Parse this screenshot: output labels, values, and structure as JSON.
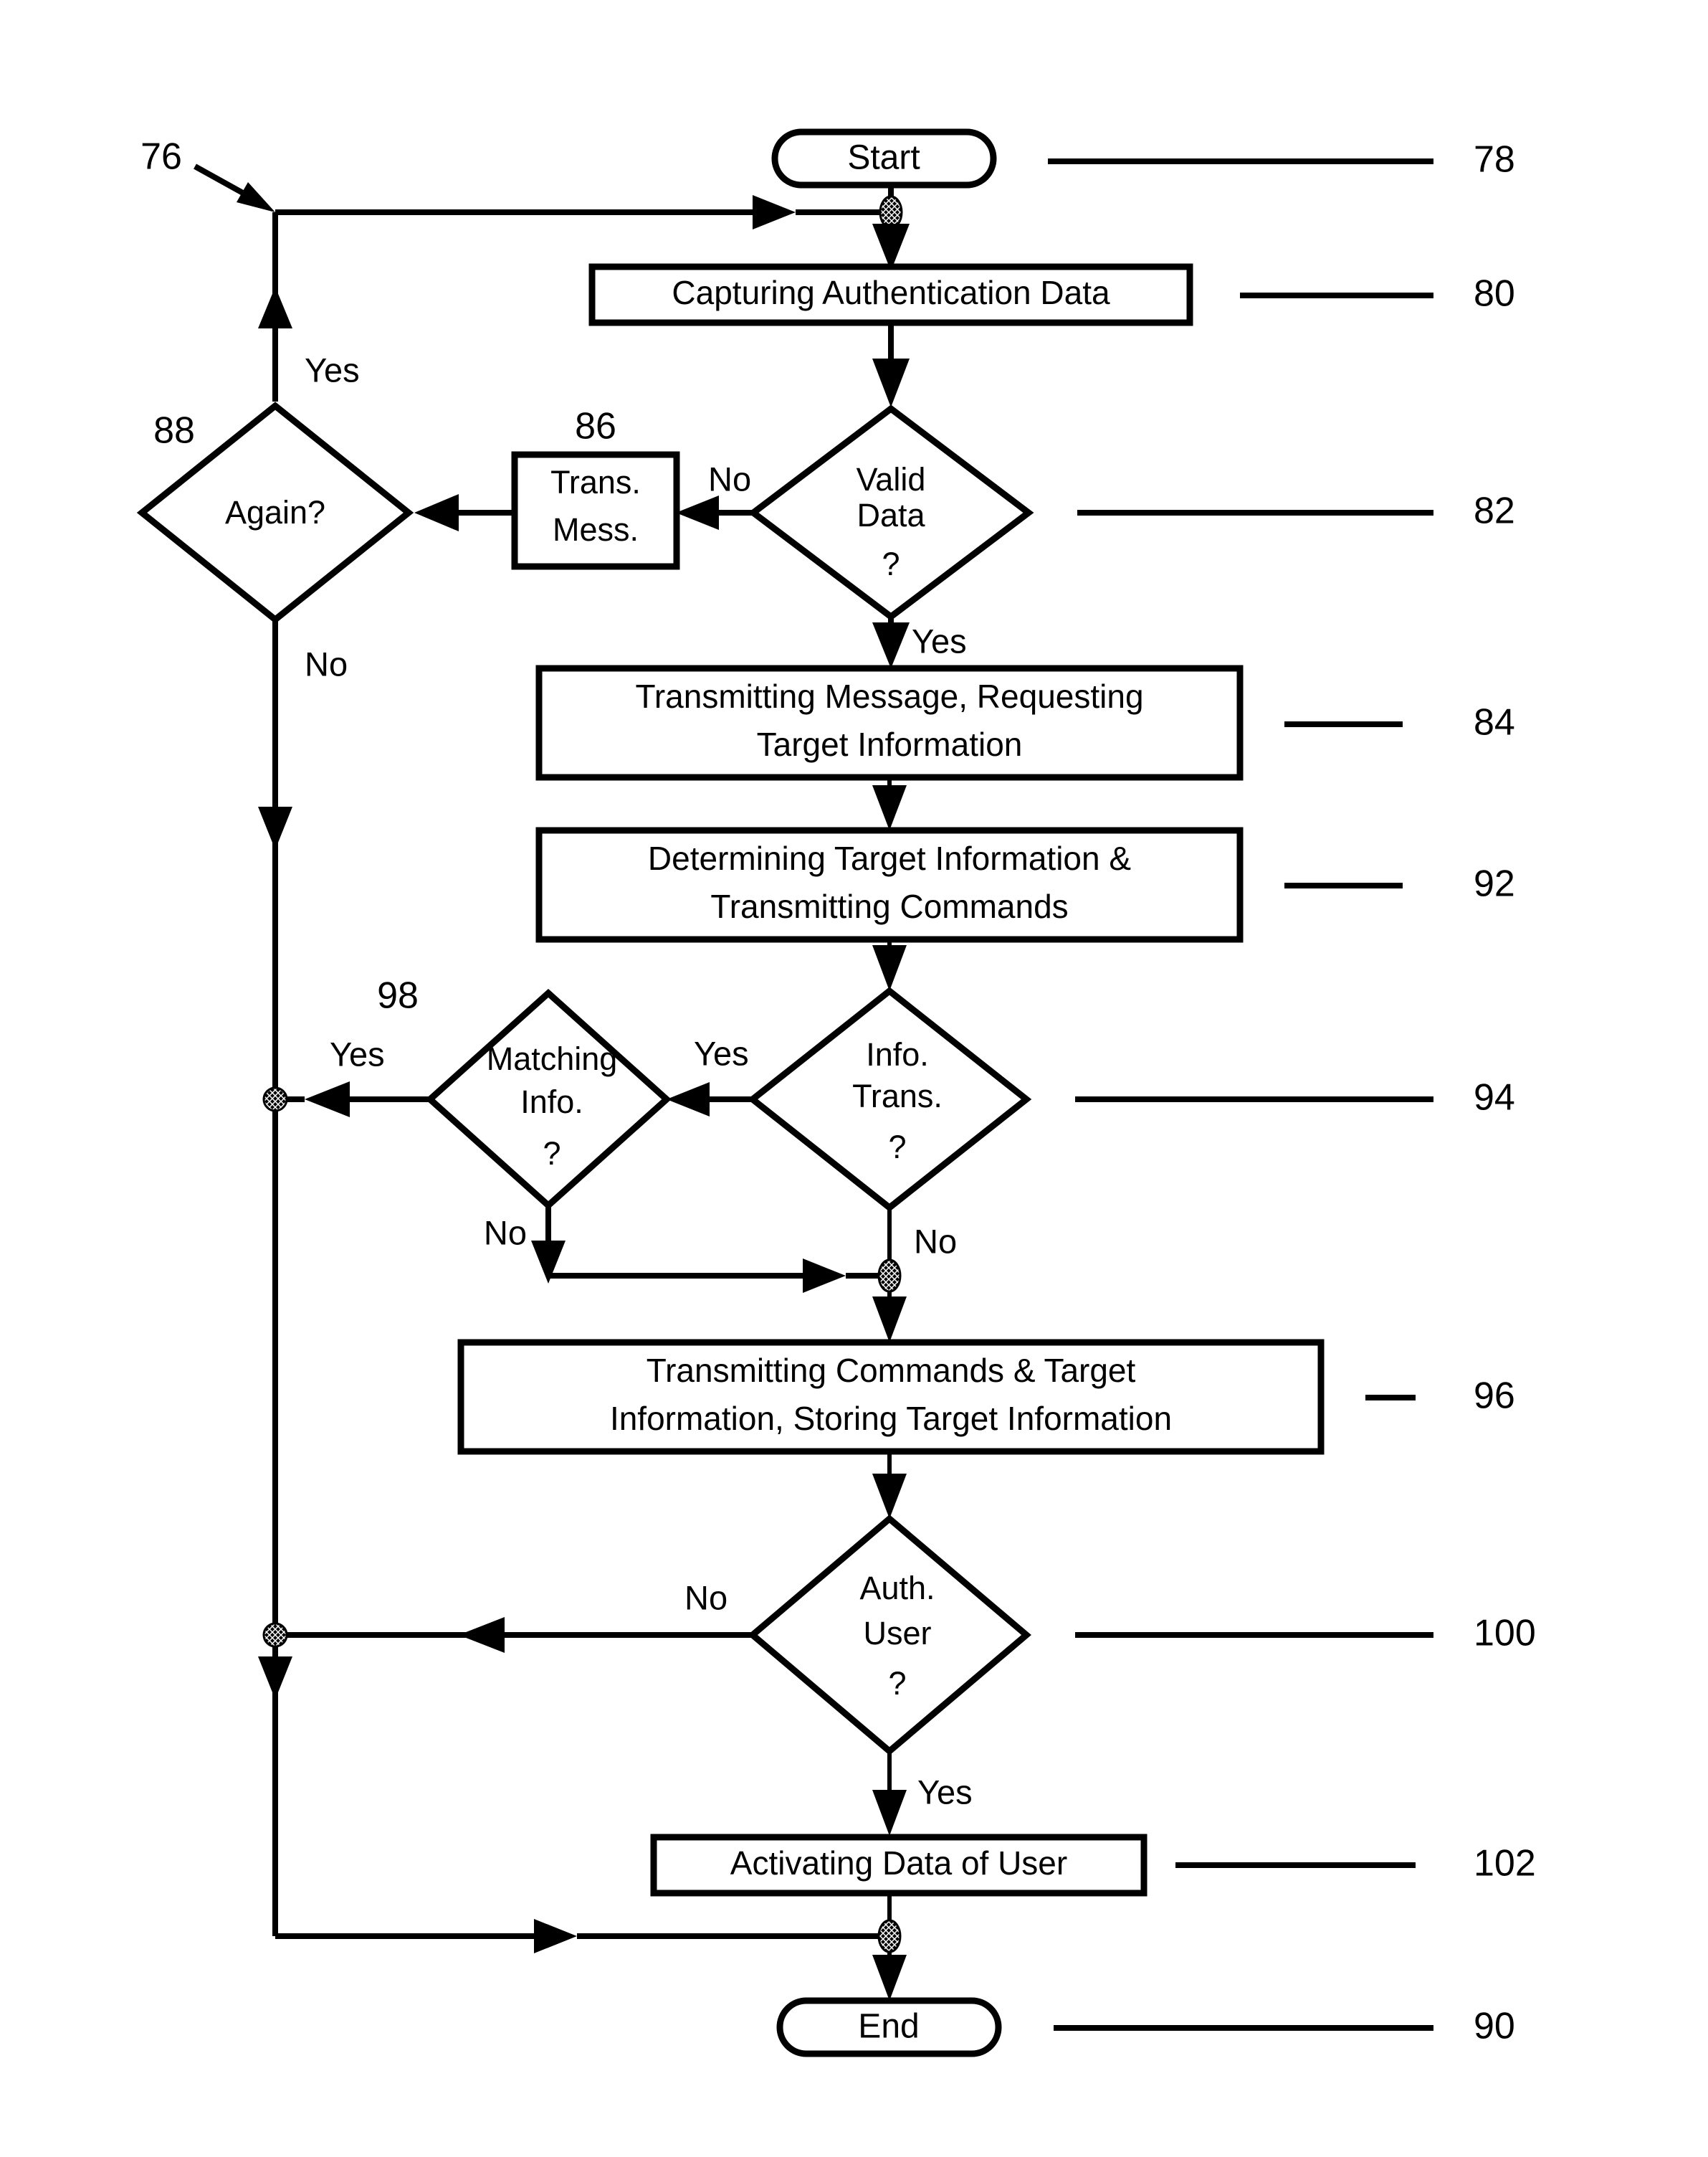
{
  "figure": {
    "type": "patent-flowchart",
    "figure_reference": "76",
    "background_color": "#ffffff",
    "line_color": "#000000"
  },
  "nodes": {
    "start": {
      "label": "Start",
      "ref": "78",
      "shape": "terminator"
    },
    "capture": {
      "label": "Capturing Authentication Data",
      "ref": "80",
      "shape": "process"
    },
    "valid_data": {
      "line1": "Valid",
      "line2": "Data",
      "line3": "?",
      "ref": "82",
      "shape": "decision"
    },
    "trans_mess": {
      "line1": "Trans.",
      "line2": "Mess.",
      "ref": "86",
      "shape": "process"
    },
    "again": {
      "label": "Again?",
      "ref": "88",
      "shape": "decision"
    },
    "transmit_msg": {
      "line1": "Transmitting Message, Requesting",
      "line2": "Target Information",
      "ref": "84",
      "shape": "process"
    },
    "determine_target": {
      "line1": "Determining Target Information &",
      "line2": "Transmitting Commands",
      "ref": "92",
      "shape": "process"
    },
    "info_trans": {
      "line1": "Info.",
      "line2": "Trans.",
      "line3": "?",
      "ref": "94",
      "shape": "decision"
    },
    "matching_info": {
      "line1": "Matching",
      "line2": "Info.",
      "line3": "?",
      "ref": "98",
      "shape": "decision"
    },
    "transmit_cmds": {
      "line1": "Transmitting Commands & Target",
      "line2": "Information, Storing Target Information",
      "ref": "96",
      "shape": "process"
    },
    "auth_user": {
      "line1": "Auth.",
      "line2": "User",
      "line3": "?",
      "ref": "100",
      "shape": "decision"
    },
    "activating": {
      "label": "Activating Data of User",
      "ref": "102",
      "shape": "process"
    },
    "end": {
      "label": "End",
      "ref": "90",
      "shape": "terminator"
    }
  },
  "edge_labels": {
    "again_yes": "Yes",
    "again_no": "No",
    "valid_no": "No",
    "valid_yes": "Yes",
    "info_trans_yes": "Yes",
    "info_trans_no": "No",
    "matching_yes": "Yes",
    "matching_no": "No",
    "auth_no": "No",
    "auth_yes": "Yes"
  },
  "reference_numerals": {
    "figure": "76",
    "start": "78",
    "capture": "80",
    "valid_data": "82",
    "transmit_msg": "84",
    "trans_mess": "86",
    "again": "88",
    "end": "90",
    "determine_target": "92",
    "info_trans": "94",
    "transmit_cmds": "96",
    "matching_info": "98",
    "auth_user": "100",
    "activating": "102"
  },
  "chart_data": {
    "type": "flowchart",
    "title": "Authentication and Target Information Process Flow",
    "steps": [
      {
        "id": "78",
        "label": "Start",
        "shape": "terminator"
      },
      {
        "id": "80",
        "label": "Capturing Authentication Data",
        "shape": "process"
      },
      {
        "id": "82",
        "label": "Valid Data ?",
        "shape": "decision"
      },
      {
        "id": "86",
        "label": "Trans. Mess.",
        "shape": "process"
      },
      {
        "id": "88",
        "label": "Again?",
        "shape": "decision"
      },
      {
        "id": "84",
        "label": "Transmitting Message, Requesting Target Information",
        "shape": "process"
      },
      {
        "id": "92",
        "label": "Determining Target Information & Transmitting Commands",
        "shape": "process"
      },
      {
        "id": "94",
        "label": "Info. Trans. ?",
        "shape": "decision"
      },
      {
        "id": "98",
        "label": "Matching Info. ?",
        "shape": "decision"
      },
      {
        "id": "96",
        "label": "Transmitting Commands & Target Information, Storing Target Information",
        "shape": "process"
      },
      {
        "id": "100",
        "label": "Auth. User ?",
        "shape": "decision"
      },
      {
        "id": "102",
        "label": "Activating Data of User",
        "shape": "process"
      },
      {
        "id": "90",
        "label": "End",
        "shape": "terminator"
      }
    ],
    "edges": [
      {
        "from": "78",
        "to": "80",
        "label": ""
      },
      {
        "from": "80",
        "to": "82",
        "label": ""
      },
      {
        "from": "82",
        "to": "86",
        "label": "No"
      },
      {
        "from": "86",
        "to": "88",
        "label": ""
      },
      {
        "from": "88",
        "to": "80",
        "label": "Yes"
      },
      {
        "from": "88",
        "to": "90",
        "label": "No"
      },
      {
        "from": "82",
        "to": "84",
        "label": "Yes"
      },
      {
        "from": "84",
        "to": "92",
        "label": ""
      },
      {
        "from": "92",
        "to": "94",
        "label": ""
      },
      {
        "from": "94",
        "to": "98",
        "label": "Yes"
      },
      {
        "from": "94",
        "to": "96",
        "label": "No"
      },
      {
        "from": "98",
        "to": "90",
        "label": "Yes"
      },
      {
        "from": "98",
        "to": "96",
        "label": "No"
      },
      {
        "from": "96",
        "to": "100",
        "label": ""
      },
      {
        "from": "100",
        "to": "90",
        "label": "No"
      },
      {
        "from": "100",
        "to": "102",
        "label": "Yes"
      },
      {
        "from": "102",
        "to": "90",
        "label": ""
      }
    ]
  }
}
